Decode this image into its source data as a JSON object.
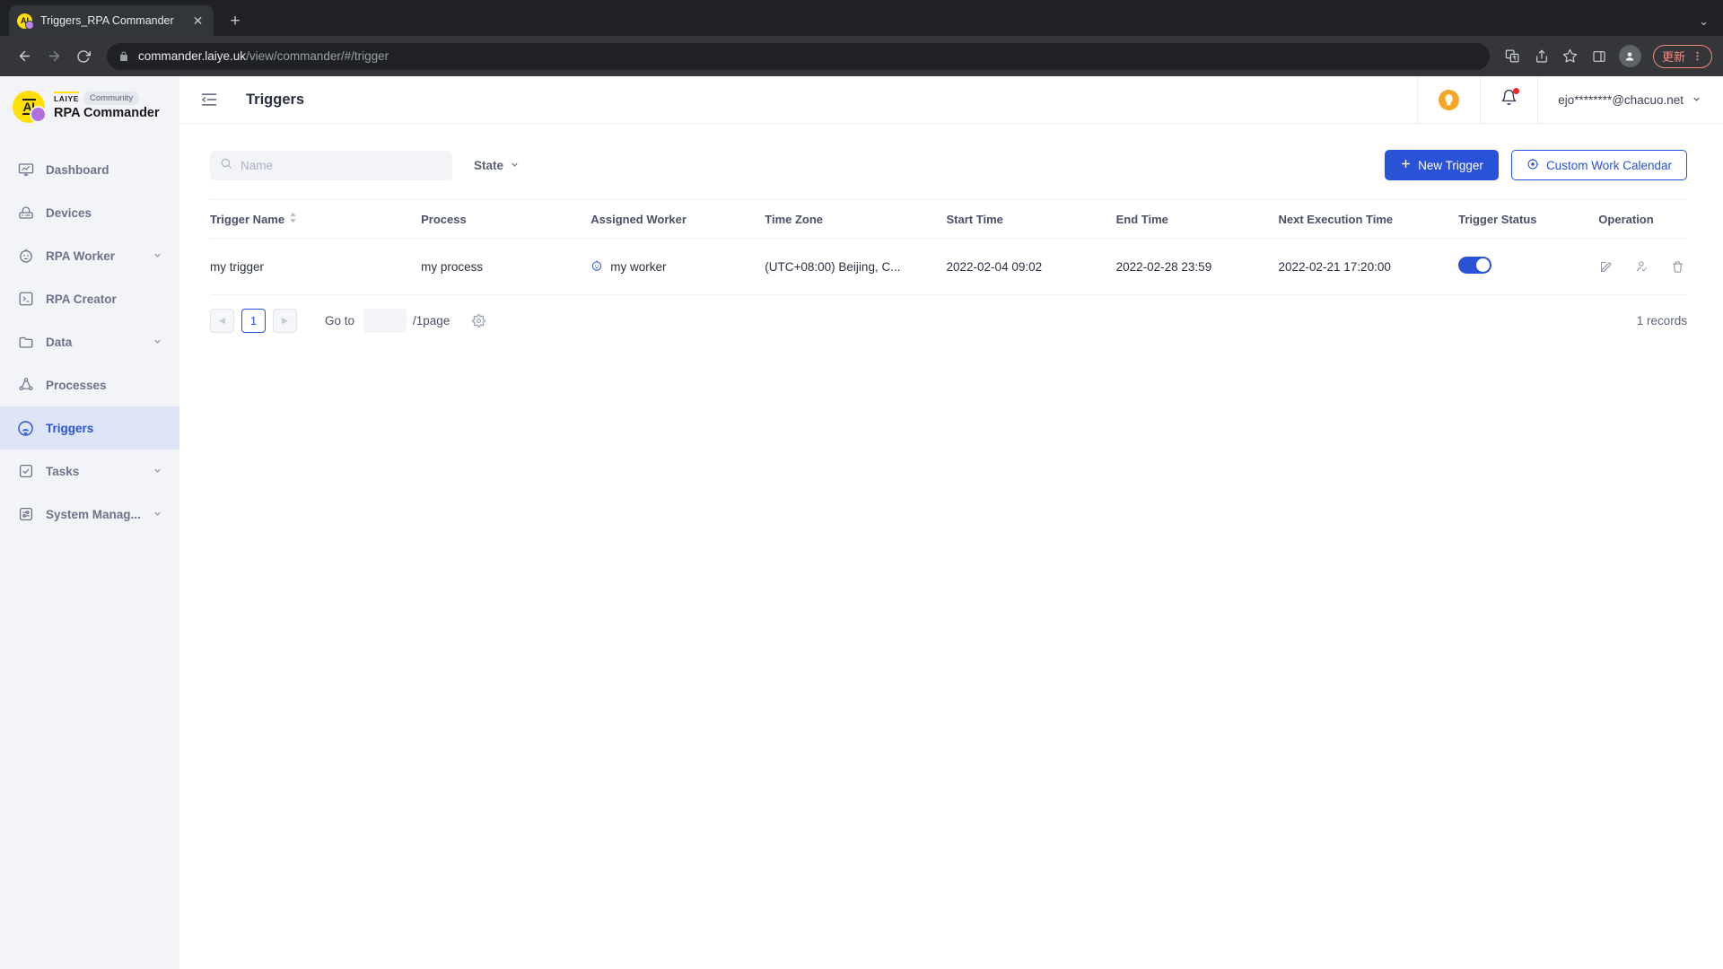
{
  "browser": {
    "tab": {
      "title": "Triggers_RPA Commander",
      "favicon_icon": "laiye-ai-favicon",
      "close_icon": "close-icon"
    },
    "newtab_icon": "plus-icon",
    "window_collapse_icon": "chevron-down-icon",
    "nav": {
      "back_icon": "back-arrow-icon",
      "forward_icon": "forward-arrow-icon",
      "reload_icon": "reload-icon"
    },
    "omnibox": {
      "lock_icon": "lock-icon",
      "url_host": "commander.laiye.uk",
      "url_path": "/view/commander/#/trigger",
      "full_url": "commander.laiye.uk/view/commander/#/trigger"
    },
    "actions": {
      "translate_icon": "translate-icon",
      "share_icon": "share-icon",
      "bookmark_icon": "star-icon",
      "sidepanel_icon": "side-panel-icon",
      "profile_icon": "profile-avatar-icon",
      "update_label": "更新",
      "menu_icon": "three-dots-menu-icon"
    }
  },
  "sidebar": {
    "brand": {
      "logo_icon": "laiye-ai-logo",
      "logo_text": "AI",
      "vendor": "LAIYE",
      "badge": "Community",
      "product": "RPA Commander"
    },
    "items": [
      {
        "label": "Dashboard",
        "icon": "dashboard-icon",
        "expandable": false,
        "active": false
      },
      {
        "label": "Devices",
        "icon": "device-icon",
        "expandable": false,
        "active": false
      },
      {
        "label": "RPA Worker",
        "icon": "robot-worker-icon",
        "expandable": true,
        "active": false
      },
      {
        "label": "RPA Creator",
        "icon": "terminal-icon",
        "expandable": false,
        "active": false
      },
      {
        "label": "Data",
        "icon": "folder-icon",
        "expandable": true,
        "active": false
      },
      {
        "label": "Processes",
        "icon": "process-graph-icon",
        "expandable": false,
        "active": false
      },
      {
        "label": "Triggers",
        "icon": "trigger-signal-icon",
        "expandable": false,
        "active": true
      },
      {
        "label": "Tasks",
        "icon": "checkbox-task-icon",
        "expandable": true,
        "active": false
      },
      {
        "label": "System Manag...",
        "icon": "settings-slider-icon",
        "expandable": true,
        "active": false
      }
    ],
    "chevron_icon": "chevron-down-icon"
  },
  "topbar": {
    "collapse_icon": "collapse-sidebar-icon",
    "title": "Triggers",
    "tip_icon": "lightbulb-icon",
    "notification_icon": "bell-icon",
    "notification_has_badge": true,
    "user_email": "ejo********@chacuo.net",
    "user_chevron_icon": "chevron-down-icon"
  },
  "toolbar": {
    "search": {
      "placeholder": "Name",
      "value": "",
      "icon": "search-icon"
    },
    "state_filter": {
      "label": "State",
      "icon": "chevron-down-icon"
    },
    "new_trigger": {
      "label": "New Trigger",
      "icon": "plus-icon"
    },
    "custom_calendar": {
      "label": "Custom Work Calendar",
      "icon": "target-gear-icon"
    }
  },
  "table": {
    "columns": [
      {
        "label": "Trigger Name",
        "sortable": true,
        "sort_icon": "sort-arrows-icon"
      },
      {
        "label": "Process",
        "sortable": false
      },
      {
        "label": "Assigned Worker",
        "sortable": false
      },
      {
        "label": "Time Zone",
        "sortable": false
      },
      {
        "label": "Start Time",
        "sortable": false
      },
      {
        "label": "End Time",
        "sortable": false
      },
      {
        "label": "Next Execution Time",
        "sortable": false
      },
      {
        "label": "Trigger Status",
        "sortable": false
      },
      {
        "label": "Operation",
        "sortable": false
      }
    ],
    "rows": [
      {
        "trigger_name": "my trigger",
        "process": "my process",
        "assigned_worker": "my worker",
        "worker_icon": "robot-head-icon",
        "time_zone": "(UTC+08:00) Beijing, C...",
        "start_time": "2022-02-04 09:02",
        "end_time": "2022-02-28 23:59",
        "next_execution_time": "2022-02-21 17:20:00",
        "status_enabled": true,
        "operations": [
          {
            "icon": "edit-icon"
          },
          {
            "icon": "assign-user-icon"
          },
          {
            "icon": "delete-trash-icon"
          }
        ]
      }
    ]
  },
  "pagination": {
    "prev_icon": "caret-left-icon",
    "next_icon": "caret-right-icon",
    "current_page": "1",
    "goto_label": "Go to",
    "goto_value": "",
    "page_suffix": "/1page",
    "settings_icon": "gear-icon",
    "records_text": "1 records"
  },
  "colors": {
    "accent": "#2a52d6",
    "sidebar_bg": "#f2f4f8",
    "active_bg": "#dee5f7",
    "brand_yellow": "#ffe000",
    "tip_orange": "#f5a623",
    "badge_red": "#f5222d"
  }
}
